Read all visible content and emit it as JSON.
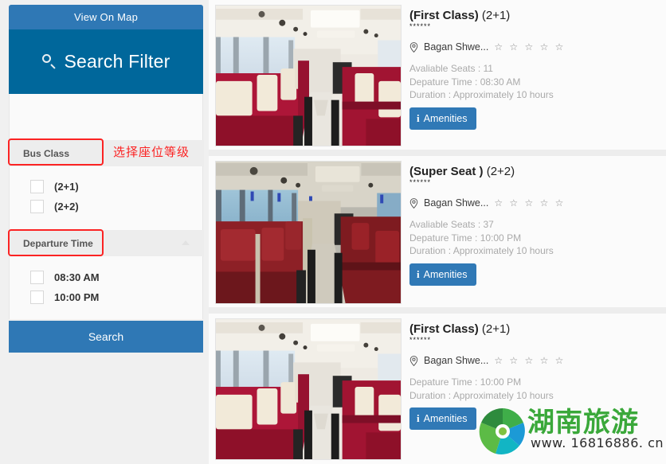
{
  "sidebar": {
    "view_on_map": "View On Map",
    "filter_title": "Search Filter",
    "search_icon": "search-icon",
    "sections": [
      {
        "header": "Bus Class",
        "options": [
          {
            "label": "(2+1)"
          },
          {
            "label": "(2+2)"
          }
        ]
      },
      {
        "header": "Departure Time",
        "collapse_icon": "chevron-up-icon",
        "options": [
          {
            "label": "08:30 AM"
          },
          {
            "label": "10:00 PM"
          }
        ]
      }
    ],
    "search_button": "Search"
  },
  "annotations": {
    "note_text": "选择座位等级",
    "note_color": "#fb2323"
  },
  "results": [
    {
      "title_bold": "(First Class)",
      "title_rest": " (2+1)",
      "small_stars": "******",
      "location": "Bagan Shwe...",
      "location_icon": "map-pin-icon",
      "rating_stars": "☆ ☆ ☆ ☆ ☆",
      "seats": "Avaliable Seats : 11",
      "departure": "Depature Time : 08:30 AM",
      "duration": "Duration : Approximately 10 hours",
      "amenities_label": "Amenities",
      "amenities_icon": "info-icon",
      "image": "bus-interior-first-class"
    },
    {
      "title_bold": "(Super Seat )",
      "title_rest": " (2+2)",
      "small_stars": "******",
      "location": "Bagan Shwe...",
      "location_icon": "map-pin-icon",
      "rating_stars": "☆ ☆ ☆ ☆ ☆",
      "seats": "Avaliable Seats : 37",
      "departure": "Depature Time : 10:00 PM",
      "duration": "Duration : Approximately 10 hours",
      "amenities_label": "Amenities",
      "amenities_icon": "info-icon",
      "image": "bus-interior-super-seat"
    },
    {
      "title_bold": "(First Class)",
      "title_rest": " (2+1)",
      "small_stars": "******",
      "location": "Bagan Shwe...",
      "location_icon": "map-pin-icon",
      "rating_stars": "☆ ☆ ☆ ☆ ☆",
      "seats": "",
      "departure": "Depature Time : 10:00 PM",
      "duration": "Duration : Approximately 10 hours",
      "amenities_label": "Amenities",
      "amenities_icon": "info-icon",
      "image": "bus-interior-first-class"
    }
  ],
  "watermark": {
    "brand": "湖南旅游",
    "url": "www. 16816886. cn",
    "logo_icon": "shutter-logo-icon",
    "brand_color": "#3aa83a"
  },
  "colors": {
    "header_blue": "#00679b",
    "button_blue": "#2f78b5",
    "accent_red": "#fb2323",
    "page_bg": "#ededed"
  }
}
